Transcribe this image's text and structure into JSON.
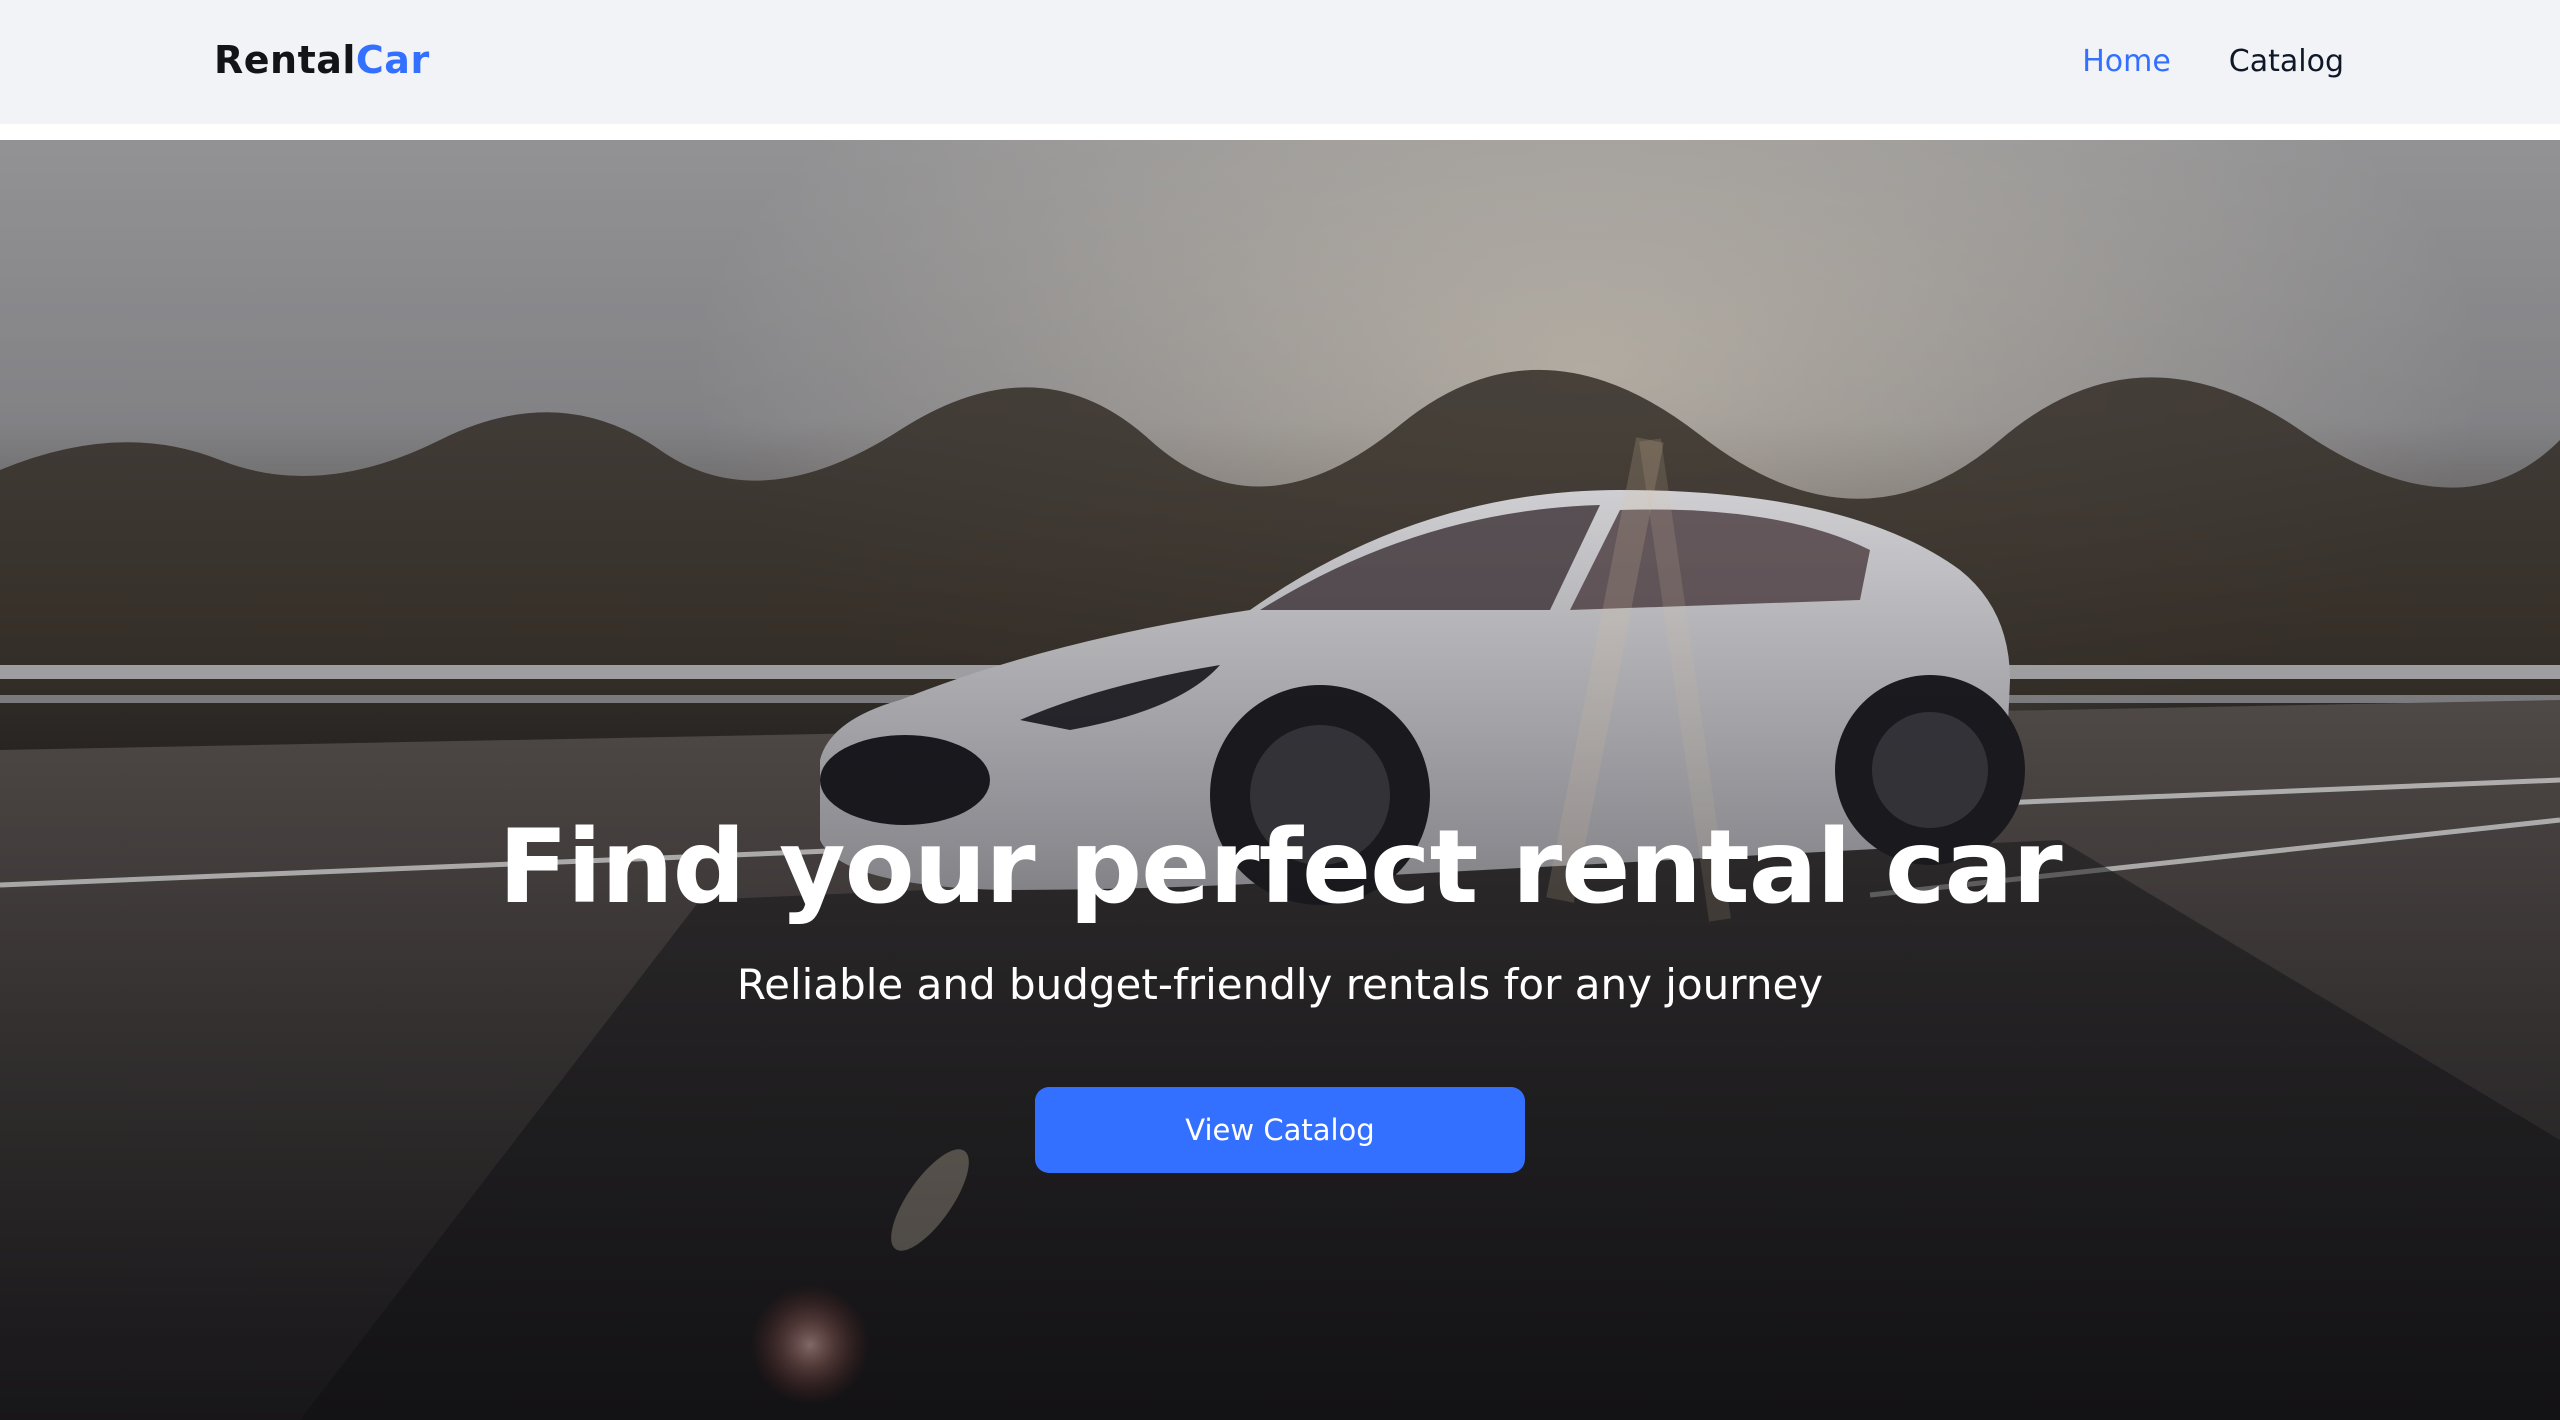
{
  "header": {
    "logo_part1": "Rental",
    "logo_part2": "Car",
    "nav": [
      {
        "label": "Home",
        "active": true
      },
      {
        "label": "Catalog",
        "active": false
      }
    ]
  },
  "hero": {
    "title": "Find your perfect rental car",
    "subtitle": "Reliable and budget-friendly rentals for any journey",
    "cta_label": "View Catalog",
    "background_image": "white-sports-car-on-highway-at-sunset"
  },
  "colors": {
    "accent": "#3470ff",
    "header_bg": "#f2f3f7",
    "text_dark": "#121417"
  }
}
